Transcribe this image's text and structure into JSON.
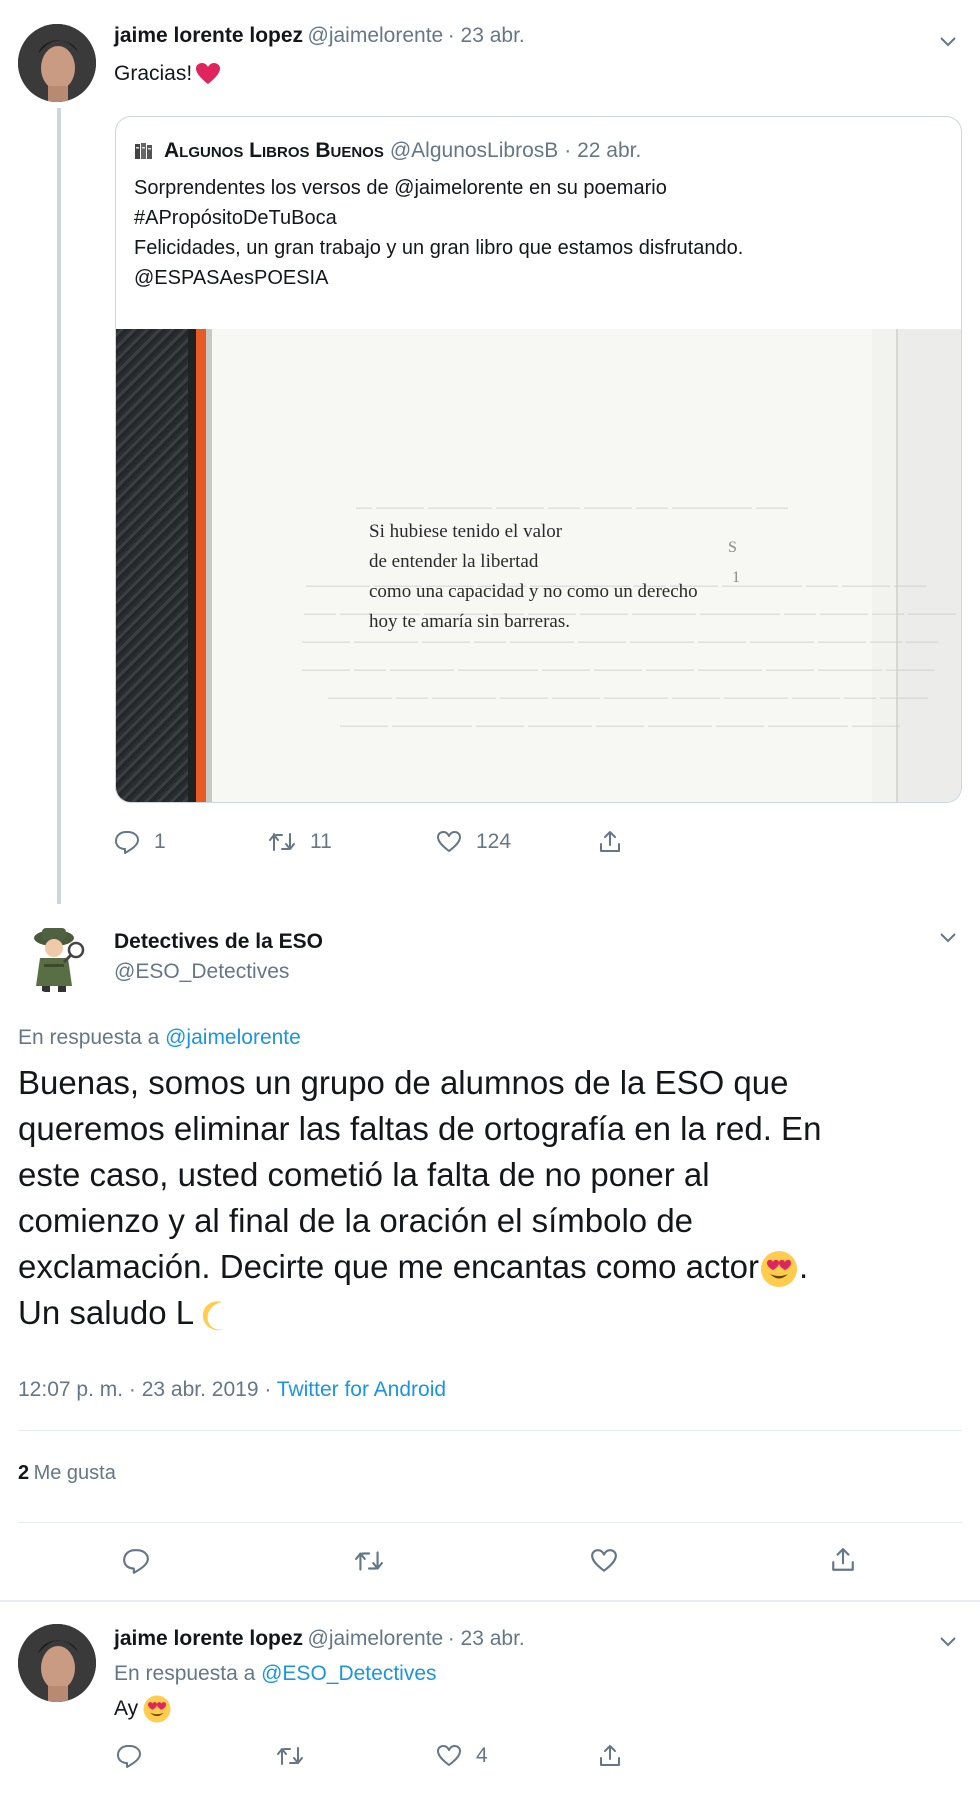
{
  "tweet1": {
    "name": "jaime lorente lopez",
    "handle": "@jaimelorente",
    "time": "· 23 abr.",
    "text": "Gracias!",
    "quote": {
      "name": "Algunos Libros Buenos",
      "handle": "@AlgunosLibrosB",
      "time": "· 22 abr.",
      "line1": "Sorprendentes los versos de @jaimelorente en su poemario",
      "hashtag": "#APropósitoDeTuBoca",
      "line3": "Felicidades, un gran trabajo y un gran libro que estamos disfrutando.",
      "mention": "@ESPASAesPOESIA",
      "poem": [
        "Si hubiese tenido el valor",
        "de entender la libertad",
        "como una capacidad y no como un derecho",
        "hoy te amaría sin barreras."
      ]
    },
    "replies": "1",
    "retweets": "11",
    "likes": "124"
  },
  "tweet2": {
    "name": "Detectives de la ESO",
    "handle": "@ESO_Detectives",
    "reply_prefix": "En respuesta a",
    "reply_to": "@jaimelorente",
    "lines": [
      "Buenas, somos un grupo de alumnos de la ESO que",
      "queremos eliminar las faltas de ortografía en la red.  En",
      "este caso, usted cometió la falta de no poner al",
      "comienzo y al final de la oración el símbolo de",
      "exclamación. Decirte que me encantas como actor",
      "Un saludo L"
    ],
    "line5_end": ".",
    "timestamp": "12:07 p. m. · 23 abr. 2019 ·",
    "client": "Twitter for Android",
    "like_count": "2",
    "like_label": "Me gusta"
  },
  "tweet3": {
    "name": "jaime lorente lopez",
    "handle": "@jaimelorente",
    "time": "· 23 abr.",
    "reply_prefix": "En respuesta a",
    "reply_to": "@ESO_Detectives",
    "text": "Ay",
    "likes": "4"
  },
  "colors": {
    "link": "#1b95e0",
    "muted": "#657786",
    "heart": "#e0245e"
  }
}
